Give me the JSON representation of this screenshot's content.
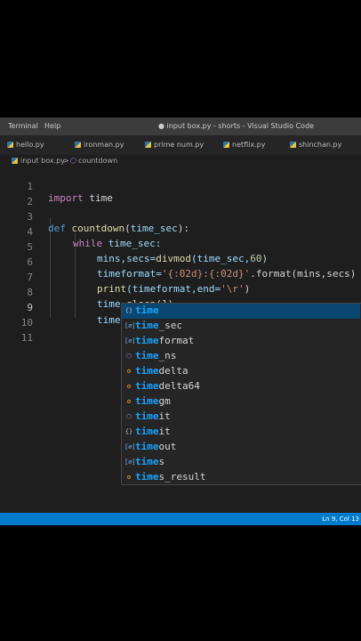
{
  "menu": {
    "items": [
      "Terminal",
      "Help"
    ]
  },
  "window_title": "● input box.py - shorts - Visual Studio Code",
  "tabs": [
    "hello.py",
    "ironman.py",
    "prime num.py",
    "netflix.py",
    "shinchan.py"
  ],
  "breadcrumb": {
    "file": "input box.py",
    "separator": ">",
    "symbol_icon": "symbol-function-icon",
    "symbol": "countdown"
  },
  "code": {
    "line_numbers": [
      "1",
      "2",
      "3",
      "4",
      "5",
      "6",
      "7",
      "8",
      "9",
      "10",
      "11"
    ],
    "l1": {
      "kw": "import",
      "rest": " time"
    },
    "l3": {
      "kw": "def",
      "fn": "countdown",
      "open": "(",
      "param": "time_sec",
      "close": "):"
    },
    "l4": {
      "kw": "while",
      "cond": " time_sec:"
    },
    "l5": {
      "lhs": "mins,secs=",
      "fn": "divmod",
      "args": "(time_sec,",
      "num": "60",
      "close": ")"
    },
    "l6": {
      "lhs": "timeformat=",
      "str": "'{:02d}:{:02d}'",
      "rest": ".format(mins,secs)"
    },
    "l7": {
      "fn": "print",
      "args": "(timeformat,end=",
      "str": "'\\r'",
      "close": ")"
    },
    "l8": {
      "obj": "time",
      "dot": ".",
      "fn": "sleep",
      "open": "(",
      "num": "1",
      "close": ")"
    },
    "l9": {
      "typed": "time"
    }
  },
  "suggestions": [
    {
      "icon": "module-icon",
      "symbol": "{}",
      "match": "time",
      "rest": ""
    },
    {
      "icon": "variable-icon",
      "symbol": "[∅]",
      "match": "time",
      "rest": "_sec"
    },
    {
      "icon": "variable-icon",
      "symbol": "[∅]",
      "match": "time",
      "rest": "format"
    },
    {
      "icon": "function-icon",
      "symbol": "⬡",
      "match": "time",
      "rest": "_ns"
    },
    {
      "icon": "class-icon",
      "symbol": "⚙",
      "match": "time",
      "rest": "delta"
    },
    {
      "icon": "class-icon",
      "symbol": "⚙",
      "match": "time",
      "rest": "delta64"
    },
    {
      "icon": "class-icon",
      "symbol": "⚙",
      "match": "time",
      "rest": "gm"
    },
    {
      "icon": "function-icon",
      "symbol": "⬡",
      "match": "time",
      "rest": "it"
    },
    {
      "icon": "module-icon",
      "symbol": "{}",
      "match": "time",
      "rest": "it"
    },
    {
      "icon": "variable-icon",
      "symbol": "[∅]",
      "match": "time",
      "rest": "out"
    },
    {
      "icon": "variable-icon",
      "symbol": "[∅]",
      "match": "time",
      "rest": "s"
    },
    {
      "icon": "class-icon",
      "symbol": "⚙",
      "match": "time",
      "rest": "s_result"
    }
  ],
  "status": {
    "position": "Ln 9, Col 13"
  },
  "colors": {
    "statusbar": "#007acc",
    "editor_bg": "#1e1e1e",
    "selection": "#094771",
    "match_highlight": "#18a3ff"
  }
}
